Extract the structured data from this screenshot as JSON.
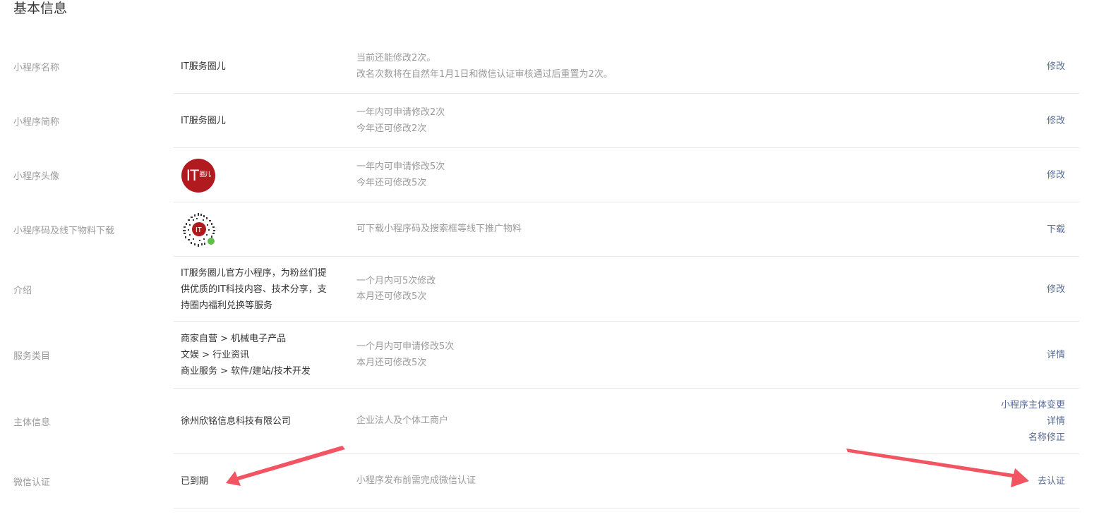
{
  "page": {
    "title": "基本信息"
  },
  "rows": [
    {
      "label": "小程序名称",
      "value": "IT服务圈儿",
      "tips": [
        "当前还能修改2次。",
        "改名次数将在自然年1月1日和微信认证审核通过后重置为2次。"
      ],
      "actions": [
        "修改"
      ]
    },
    {
      "label": "小程序简称",
      "value": "IT服务圈儿",
      "tips": [
        "一年内可申请修改2次",
        "今年还可修改2次"
      ],
      "actions": [
        "修改"
      ]
    },
    {
      "label": "小程序头像",
      "avatar_text": "IT",
      "avatar_sub": "圈儿",
      "tips": [
        "一年内可申请修改5次",
        "今年还可修改5次"
      ],
      "actions": [
        "修改"
      ]
    },
    {
      "label": "小程序码及线下物料下载",
      "tips": [
        "可下载小程序码及搜索框等线下推广物料"
      ],
      "actions": [
        "下载"
      ]
    },
    {
      "label": "介绍",
      "value_lines": [
        "IT服务圈儿官方小程序，为粉丝们提",
        "供优质的IT科技内容、技术分享，支",
        "持圈内福利兑换等服务"
      ],
      "tips": [
        "一个月内可5次修改",
        "本月还可修改5次"
      ],
      "actions": [
        "修改"
      ]
    },
    {
      "label": "服务类目",
      "value_lines": [
        "商家自营 > 机械电子产品",
        "文娱 > 行业资讯",
        "商业服务 > 软件/建站/技术开发"
      ],
      "tips": [
        "一个月内可申请修改5次",
        "本月还可修改5次"
      ],
      "actions": [
        "详情"
      ]
    },
    {
      "label": "主体信息",
      "value": "徐州欣铭信息科技有限公司",
      "tips": [
        "企业法人及个体工商户"
      ],
      "actions": [
        "小程序主体变更",
        "详情",
        "名称修正"
      ]
    },
    {
      "label": "微信认证",
      "value": "已到期",
      "tips": [
        "小程序发布前需完成微信认证"
      ],
      "actions": [
        "去认证"
      ]
    }
  ],
  "colors": {
    "link": "#576b95",
    "label": "#9a9a9a",
    "text": "#353535",
    "divider": "#e7e7eb",
    "avatar_bg": "#b11a1f",
    "annotation_arrow": "#f25462"
  },
  "icons": {
    "avatar": "it-circle-logo-icon",
    "qrcode": "mini-program-code-icon",
    "annotation": "red-arrow-icon"
  }
}
